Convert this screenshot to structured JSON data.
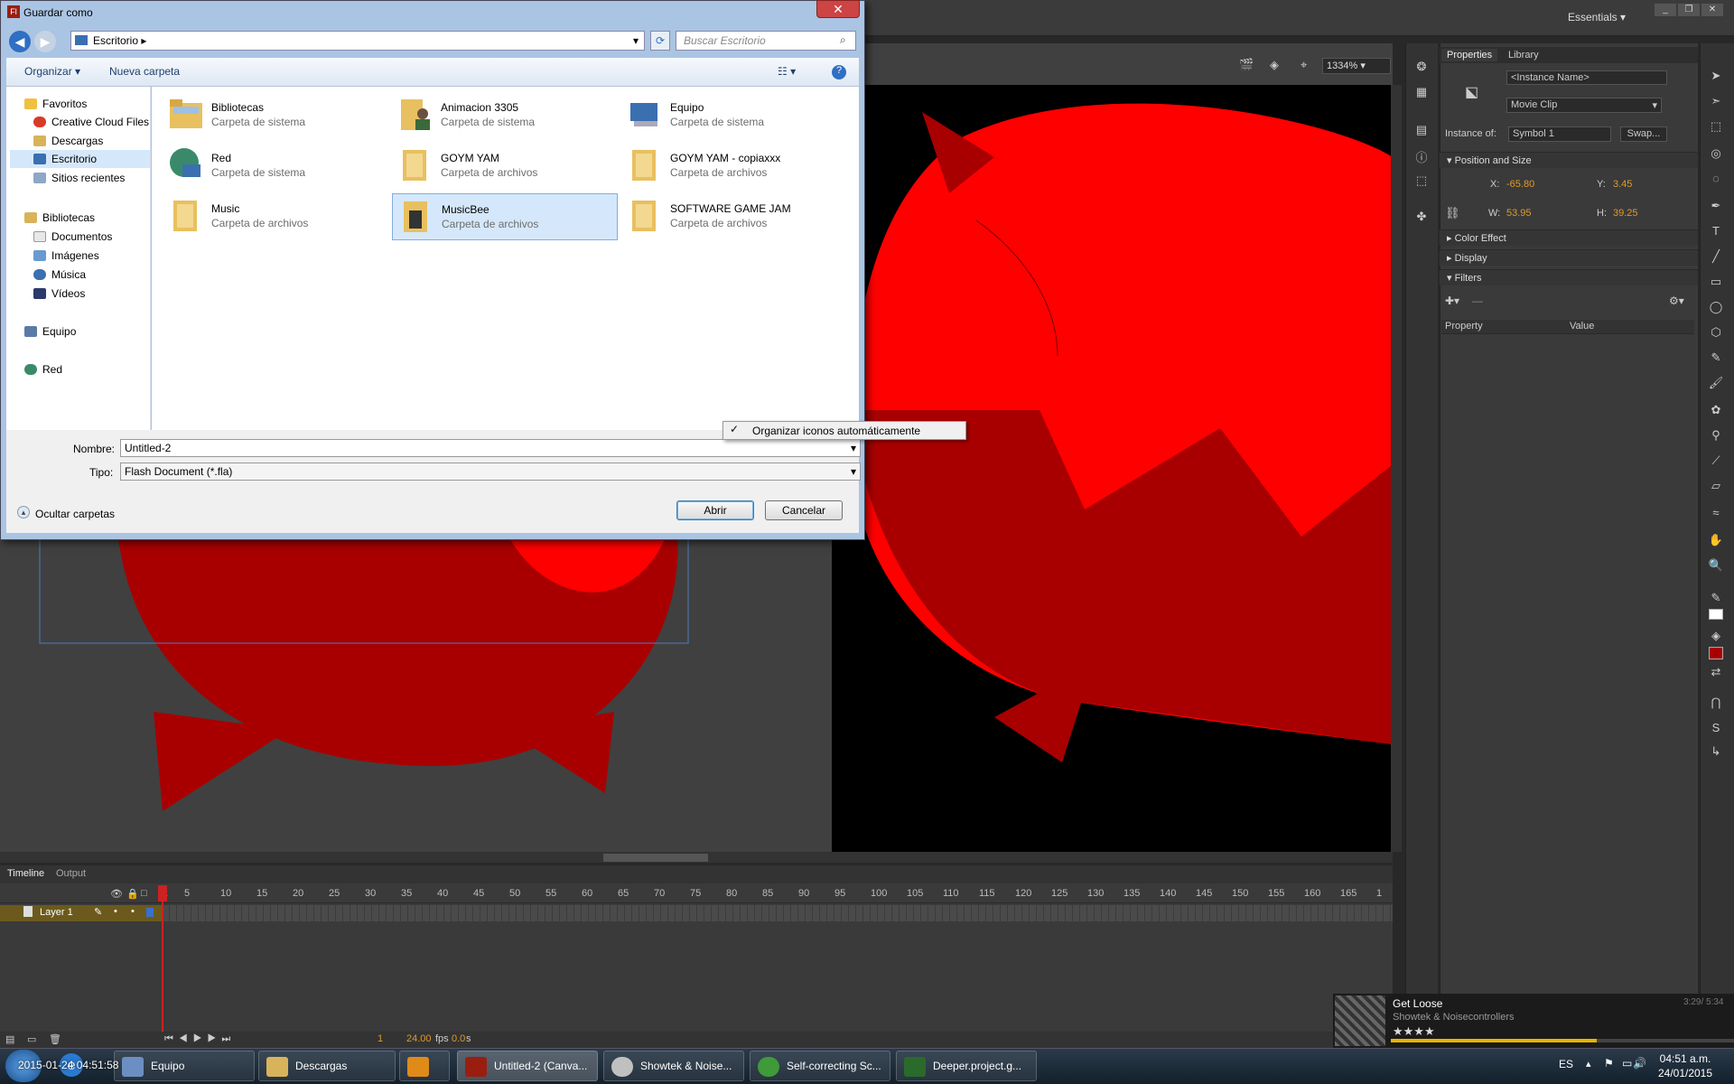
{
  "app": {
    "workspace": "Essentials",
    "zoom": "1334%"
  },
  "dialog": {
    "title": "Guardar como",
    "address": "Escritorio",
    "search_placeholder": "Buscar Escritorio",
    "toolbar": {
      "organize": "Organizar",
      "new_folder": "Nueva carpeta"
    },
    "nav": {
      "favorites": "Favoritos",
      "creative_cloud": "Creative Cloud Files",
      "downloads": "Descargas",
      "desktop": "Escritorio",
      "recent": "Sitios recientes",
      "libraries": "Bibliotecas",
      "documents": "Documentos",
      "images": "Imágenes",
      "music": "Música",
      "videos": "Vídeos",
      "computer": "Equipo",
      "network": "Red"
    },
    "files": [
      {
        "name": "Bibliotecas",
        "sub": "Carpeta de sistema"
      },
      {
        "name": "Animacion 3305",
        "sub": "Carpeta de sistema"
      },
      {
        "name": "Equipo",
        "sub": "Carpeta de sistema"
      },
      {
        "name": "Red",
        "sub": "Carpeta de sistema"
      },
      {
        "name": "GOYM YAM",
        "sub": "Carpeta de archivos"
      },
      {
        "name": "GOYM YAM - copiaxxx",
        "sub": "Carpeta de archivos"
      },
      {
        "name": "Music",
        "sub": "Carpeta de archivos"
      },
      {
        "name": "MusicBee",
        "sub": "Carpeta de archivos"
      },
      {
        "name": "SOFTWARE GAME JAM",
        "sub": "Carpeta de archivos"
      }
    ],
    "context_menu_item": "Organizar iconos automáticamente",
    "name_label": "Nombre:",
    "name_value": "Untitled-2",
    "type_label": "Tipo:",
    "type_value": "Flash Document (*.fla)",
    "hide_folders": "Ocultar carpetas",
    "open_btn": "Abrir",
    "cancel_btn": "Cancelar"
  },
  "properties": {
    "tab_properties": "Properties",
    "tab_library": "Library",
    "instance_name_placeholder": "<Instance Name>",
    "symbol_type": "Movie Clip",
    "instance_of_label": "Instance of:",
    "instance_of_value": "Symbol 1",
    "swap_btn": "Swap...",
    "position_size": "Position and Size",
    "x_label": "X:",
    "x_value": "-65.80",
    "y_label": "Y:",
    "y_value": "3.45",
    "w_label": "W:",
    "w_value": "53.95",
    "h_label": "H:",
    "h_value": "39.25",
    "color_effect": "Color Effect",
    "display": "Display",
    "filters": "Filters",
    "col_property": "Property",
    "col_value": "Value"
  },
  "timeline": {
    "tab_timeline": "Timeline",
    "tab_output": "Output",
    "layer_name": "Layer 1",
    "frame_numbers": [
      "1",
      "5",
      "10",
      "15",
      "20",
      "25",
      "30",
      "35",
      "40",
      "45",
      "50",
      "55",
      "60",
      "65",
      "70",
      "75",
      "80",
      "85",
      "90",
      "95",
      "100",
      "105",
      "110",
      "115",
      "120",
      "125",
      "130",
      "135",
      "140",
      "145",
      "150",
      "155",
      "160",
      "165",
      "1"
    ],
    "current_frame": "1",
    "fps": "24.00",
    "fps_unit": "fps",
    "time": "0.0",
    "time_unit": "s"
  },
  "now_playing": {
    "title": "Get Loose",
    "artist": "Showtek & Noisecontrollers",
    "time": "3:29/ 5:34",
    "rating": "★★★★",
    "progress": 0.6
  },
  "taskbar": {
    "items": [
      {
        "label": "Equipo",
        "color": "#6b8fc2"
      },
      {
        "label": "Descargas",
        "color": "#d8b35a"
      },
      {
        "label": "",
        "color": "#e08a1a"
      },
      {
        "label": "Untitled-2 (Canva...",
        "color": "#9a1e10"
      },
      {
        "label": "Showtek & Noise...",
        "color": "#c0c0c0"
      },
      {
        "label": "Self-correcting Sc...",
        "color": "#3f9a3a"
      },
      {
        "label": "Deeper.project.g...",
        "color": "#2a6a2a"
      }
    ],
    "lang": "ES",
    "time": "04:51 a.m.",
    "date": "24/01/2015",
    "watermark": "2015-01-24 04:51:58"
  },
  "colors": {
    "accent_red": "#ff0000",
    "dark_red": "#a80000",
    "selection_blue": "#d5e8fb"
  }
}
